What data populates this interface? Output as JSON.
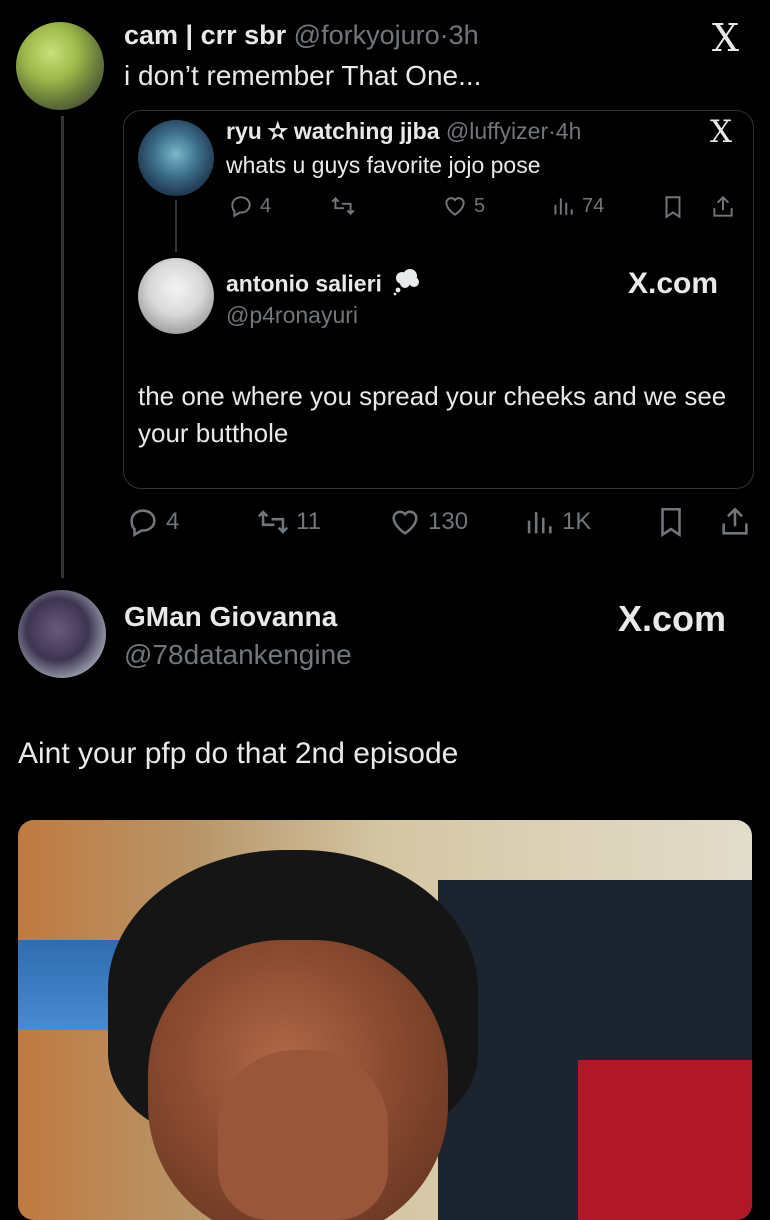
{
  "tweet": {
    "display_name": "cam | crr sbr",
    "handle": "@forkyojuro",
    "sep": "·",
    "time": "3h",
    "text": "i don’t remember That One...",
    "stats": {
      "replies": "4",
      "reposts": "11",
      "likes": "130",
      "views": "1K"
    }
  },
  "quoted": {
    "display_name": "ryu ✫ watching jjba",
    "handle": "@luffyizer",
    "sep": "·",
    "time": "4h",
    "text": "whats u guys favorite jojo pose",
    "stats": {
      "replies": "4",
      "reposts": "",
      "likes": "5",
      "views": "74"
    }
  },
  "quoted_reply": {
    "display_name": "antonio salieri",
    "handle": "@p4ronayuri",
    "source": "X.com",
    "text": "the one where you spread your cheeks and we see your butthole"
  },
  "reply": {
    "display_name": "GMan Giovanna",
    "handle": "@78datankengine",
    "source": "X.com",
    "text": "Aint your pfp do that 2nd episode"
  },
  "icons": {
    "x_logo": "X",
    "thought_bubble": "thought-bubble-icon",
    "reply": "reply-icon",
    "repost": "repost-icon",
    "like": "heart-icon",
    "views": "views-icon",
    "bookmark": "bookmark-icon",
    "share": "share-icon"
  },
  "colors": {
    "background": "#000000",
    "text": "#e7e9ea",
    "muted": "#71767b",
    "border": "#2f3336"
  }
}
